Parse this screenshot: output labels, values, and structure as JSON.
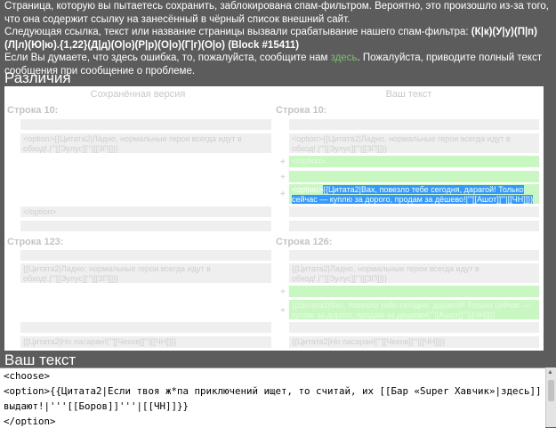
{
  "notice": {
    "line1": "Страница, которую вы пытаетесь сохранить, заблокирована спам-фильтром. Вероятно, это произошло из-за того, что она содержит ссылку на занесённый в чёрный список внешний сайт.",
    "line2": "Следующая ссылка, текст или название страницы вызвали срабатывание нашего спам-фильтра:",
    "rule": "(К|к)(У|у)(П|п)(Л|л)(Ю|ю).{1,22}(Д|д)(О|о)(Р|р)(О|о)(Г|г)(О|о) (Block #15411)",
    "line3_before": "Если Вы думаете, что здесь ошибка, то, пожалуйста, сообщите нам",
    "line3_link": "здесь",
    "line3_after": ". Пожалуйста, приводите полный текст сообщения при сообщение о проблеме."
  },
  "diff": {
    "title": "Различия",
    "left_header": "Сохранённая версия",
    "right_header": "Ваш текст",
    "block1": {
      "left_label": "Строка 10:",
      "right_label": "Строка 10:",
      "left_option": "<option>{{Цитата2|Ладно, нормальные герои всегда идут в обход!.|'''[[Эулус]]'''|[[ЗП]]}}",
      "right_option": "<option>{{Цитата2|Ладно, нормальные герои всегда идут в обход!.|'''[[Эулус]]'''|[[ЗП]]}}",
      "added_1": "</option>",
      "added_3_prefix": "<option>",
      "added_3_highlight": "{{Цитата2|Вах, повезло тебе сегодня, дарагой! Только сейчас — куплю за дорого, продам за дёшево!|'''[[Ашот]]'''|[[ЧН]]}}",
      "left_close": "</option>",
      "plus": "+"
    },
    "block2": {
      "left_label": "Строка 123:",
      "right_label": "Строка 126:",
      "left_text": "{{Цитата2|Ладно, нормальные герои всегда идут в обход!.|'''[[Эулус]]'''|[[ЗП]]}}",
      "right_text": "{{Цитата2|Ладно, нормальные герои всегда идут в обход!.|'''[[Эулус]]'''|[[ЗП]]}}",
      "added_2": "{{Цитата2|Вах, повезло тебе сегодня, дарагой! Только сейчас — куплю за дорого, продам за дешево!|'''[[Ашот]]'''|[[ЧН]]}}",
      "left_bottom": "{{Цитата2|Но пасаран!|'''[[Чехов]]'''|[[ЧН]]}}",
      "right_bottom": "{{Цитата2|Но пасаран!|'''[[Чехов]]'''|[[ЧН]]}}",
      "plus": "+"
    }
  },
  "editor": {
    "title": "Ваш текст",
    "lines": [
      "<choose>",
      "<option>{{Цитата2|Если твоя ж*па приключений ищет, то считай, их [[Бар «Super Хавчик»|здесь]]",
      "выдают!|'''[[Боров]]'''|[[ЧН]]}}",
      "</option>"
    ]
  }
}
